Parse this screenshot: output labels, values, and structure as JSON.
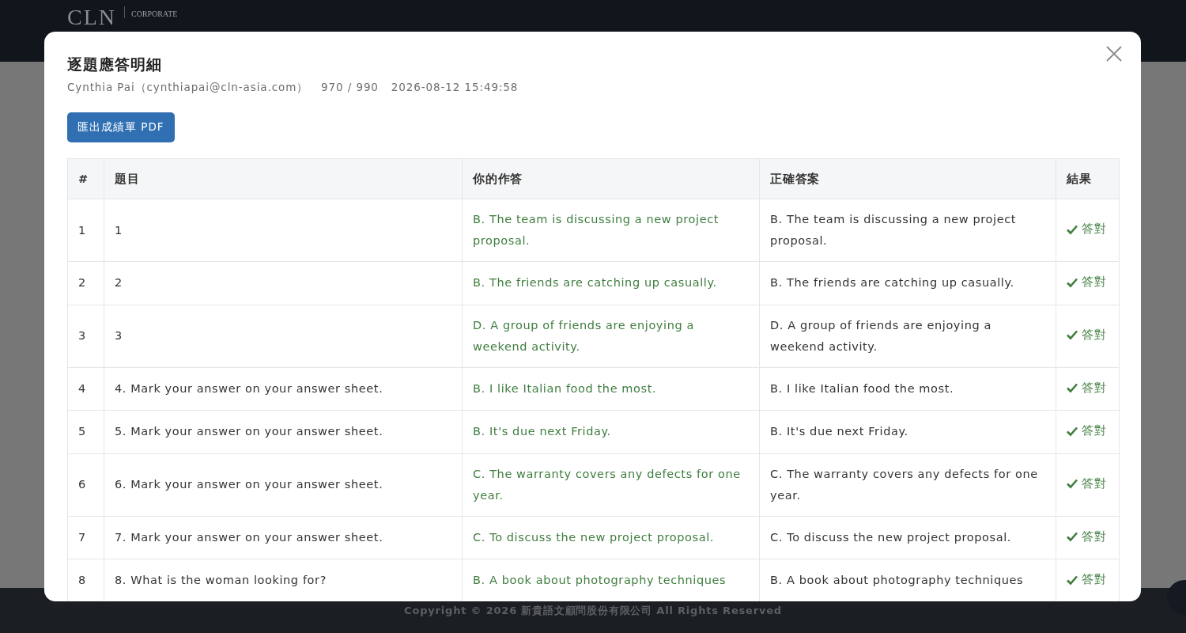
{
  "site_header": {
    "logo": "CLN",
    "tagline": "CORPORATE"
  },
  "footer": {
    "copyright": "Copyright © 2026 新貴語文顧問股份有限公司 All Rights Reserved"
  },
  "dialog": {
    "title": "逐題應答明細",
    "meta": [
      "Cynthia Pai（cynthiapai@cln-asia.com）",
      "970 / 990",
      "2026-08-12 15:49:58"
    ],
    "export_button": "匯出成績單 PDF",
    "table": {
      "columns": [
        "#",
        "題目",
        "你的作答",
        "正確答案",
        "結果"
      ],
      "rows": [
        {
          "number": "1",
          "question": "1",
          "your_answer": "B. The team is discussing a new project proposal.",
          "correct_answer": "B. The team is discussing a new project proposal.",
          "result": "答對",
          "correct": true
        },
        {
          "number": "2",
          "question": "2",
          "your_answer": "B. The friends are catching up casually.",
          "correct_answer": "B. The friends are catching up casually.",
          "result": "答對",
          "correct": true
        },
        {
          "number": "3",
          "question": "3",
          "your_answer": "D. A group of friends are enjoying a weekend activity.",
          "correct_answer": "D. A group of friends are enjoying a weekend activity.",
          "result": "答對",
          "correct": true
        },
        {
          "number": "4",
          "question": "4. Mark your answer on your answer sheet.",
          "your_answer": "B. I like Italian food the most.",
          "correct_answer": "B. I like Italian food the most.",
          "result": "答對",
          "correct": true
        },
        {
          "number": "5",
          "question": "5. Mark your answer on your answer sheet.",
          "your_answer": "B. It's due next Friday.",
          "correct_answer": "B. It's due next Friday.",
          "result": "答對",
          "correct": true
        },
        {
          "number": "6",
          "question": "6. Mark your answer on your answer sheet.",
          "your_answer": "C. The warranty covers any defects for one year.",
          "correct_answer": "C. The warranty covers any defects for one year.",
          "result": "答對",
          "correct": true
        },
        {
          "number": "7",
          "question": "7. Mark your answer on your answer sheet.",
          "your_answer": "C. To discuss the new project proposal.",
          "correct_answer": "C. To discuss the new project proposal.",
          "result": "答對",
          "correct": true
        },
        {
          "number": "8",
          "question": "8. What is the woman looking for?",
          "your_answer": "B. A book about photography techniques",
          "correct_answer": "B. A book about photography techniques",
          "result": "答對",
          "correct": true
        }
      ]
    }
  }
}
